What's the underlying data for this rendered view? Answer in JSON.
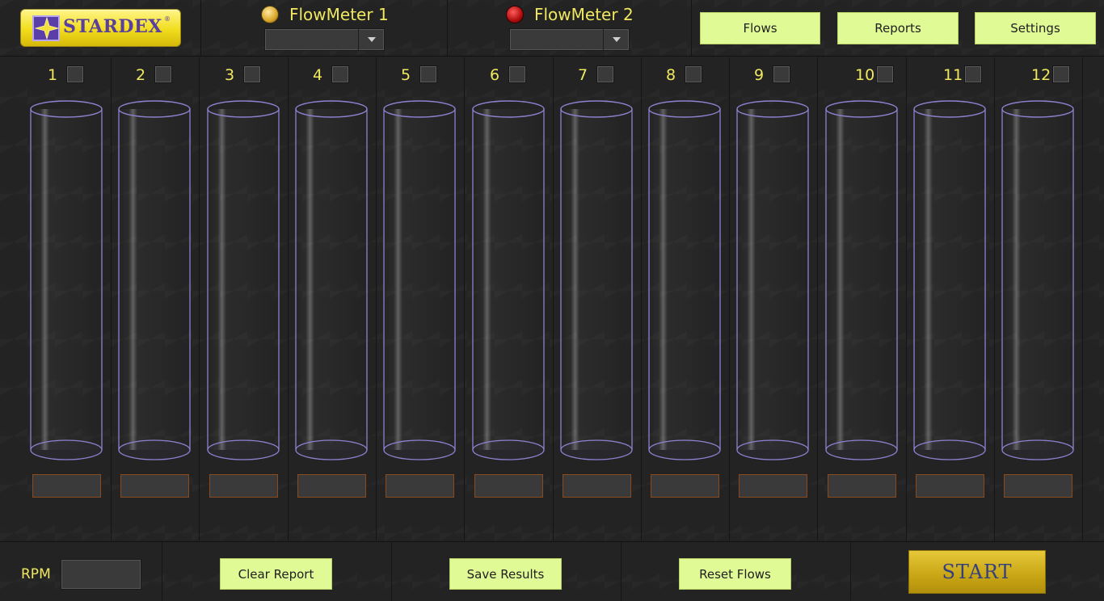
{
  "header": {
    "logo": {
      "brand": "STARDEX",
      "mark": "®"
    },
    "flowmeters": [
      {
        "label": "FlowMeter 1",
        "status": "on",
        "selected": ""
      },
      {
        "label": "FlowMeter 2",
        "status": "off",
        "selected": ""
      }
    ],
    "nav": {
      "flows": "Flows",
      "reports": "Reports",
      "settings": "Settings"
    }
  },
  "columns": [
    {
      "number": "1",
      "checked": false,
      "value": ""
    },
    {
      "number": "2",
      "checked": false,
      "value": ""
    },
    {
      "number": "3",
      "checked": false,
      "value": ""
    },
    {
      "number": "4",
      "checked": false,
      "value": ""
    },
    {
      "number": "5",
      "checked": false,
      "value": ""
    },
    {
      "number": "6",
      "checked": false,
      "value": ""
    },
    {
      "number": "7",
      "checked": false,
      "value": ""
    },
    {
      "number": "8",
      "checked": false,
      "value": ""
    },
    {
      "number": "9",
      "checked": false,
      "value": ""
    },
    {
      "number": "10",
      "checked": false,
      "value": ""
    },
    {
      "number": "11",
      "checked": false,
      "value": ""
    },
    {
      "number": "12",
      "checked": false,
      "value": ""
    }
  ],
  "footer": {
    "rpm_label": "RPM",
    "rpm_value": "",
    "clear_report": "Clear Report",
    "save_results": "Save Results",
    "reset_flows": "Reset Flows",
    "start": "START"
  },
  "colors": {
    "accent_text": "#f0e860",
    "light_button": "#e0fa96",
    "start_button": "#c8a514",
    "tube_outline": "#8d82d0",
    "led_on": "#d8a628",
    "led_off": "#b00d0d"
  }
}
